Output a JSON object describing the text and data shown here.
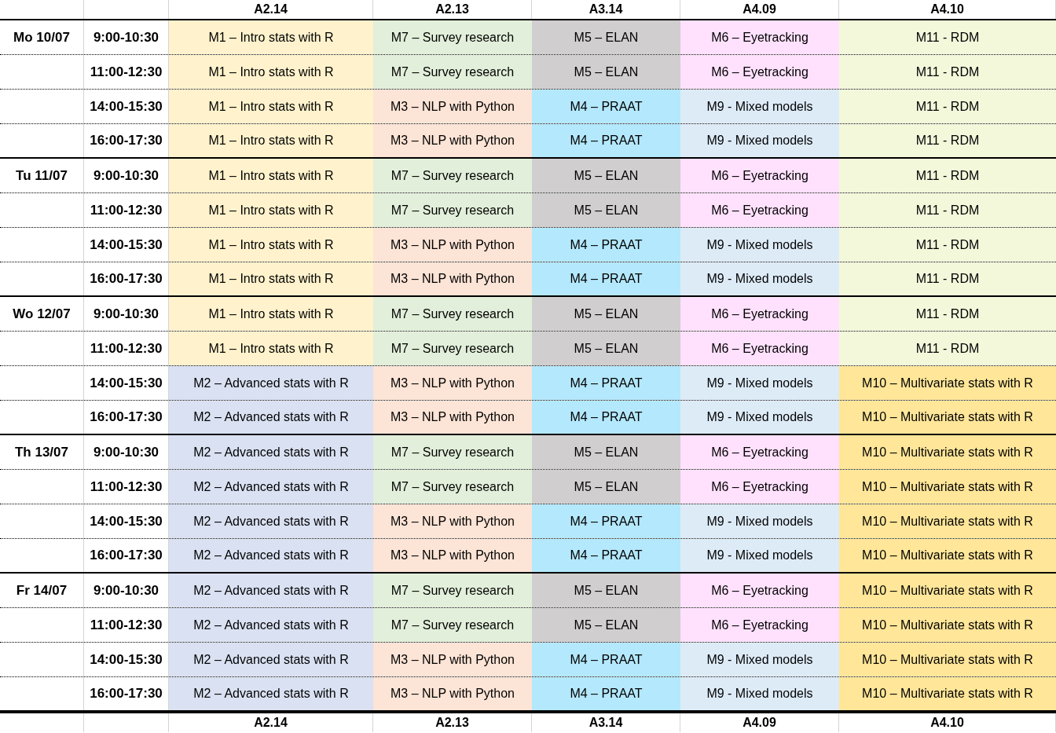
{
  "header": {
    "columns": [
      "A2.14",
      "A2.13",
      "A3.14",
      "A4.09",
      "A4.10"
    ]
  },
  "days": [
    {
      "label": "Mo 10/07",
      "slots": [
        {
          "time": "9:00-10:30",
          "cells": [
            {
              "text": "M1 – Intro stats with R",
              "color": "#fff2cc"
            },
            {
              "text": "M7 – Survey research",
              "color": "#e2efda"
            },
            {
              "text": "M5 – ELAN",
              "color": "#d0cece"
            },
            {
              "text": "M6 – Eyetracking",
              "color": "#ffe1fd"
            },
            {
              "text": "M11 - RDM",
              "color": "#f3f8db"
            }
          ]
        },
        {
          "time": "11:00-12:30",
          "cells": [
            {
              "text": "M1 – Intro stats with R",
              "color": "#fff2cc"
            },
            {
              "text": "M7 – Survey research",
              "color": "#e2efda"
            },
            {
              "text": "M5 – ELAN",
              "color": "#d0cece"
            },
            {
              "text": "M6 – Eyetracking",
              "color": "#ffe1fd"
            },
            {
              "text": "M11 - RDM",
              "color": "#f3f8db"
            }
          ]
        },
        {
          "time": "14:00-15:30",
          "cells": [
            {
              "text": "M1 – Intro stats with R",
              "color": "#fff2cc"
            },
            {
              "text": "M3 – NLP with Python",
              "color": "#fce4d6"
            },
            {
              "text": "M4 – PRAAT",
              "color": "#b4e8fc"
            },
            {
              "text": "M9 - Mixed models",
              "color": "#ddebf7"
            },
            {
              "text": "M11 - RDM",
              "color": "#f3f8db"
            }
          ]
        },
        {
          "time": "16:00-17:30",
          "cells": [
            {
              "text": "M1 – Intro stats with R",
              "color": "#fff2cc"
            },
            {
              "text": "M3 – NLP with Python",
              "color": "#fce4d6"
            },
            {
              "text": "M4 – PRAAT",
              "color": "#b4e8fc"
            },
            {
              "text": "M9 - Mixed models",
              "color": "#ddebf7"
            },
            {
              "text": "M11 - RDM",
              "color": "#f3f8db"
            }
          ]
        }
      ]
    },
    {
      "label": "Tu 11/07",
      "slots": [
        {
          "time": "9:00-10:30",
          "cells": [
            {
              "text": "M1 – Intro stats with R",
              "color": "#fff2cc"
            },
            {
              "text": "M7 – Survey research",
              "color": "#e2efda"
            },
            {
              "text": "M5 – ELAN",
              "color": "#d0cece"
            },
            {
              "text": "M6 – Eyetracking",
              "color": "#ffe1fd"
            },
            {
              "text": "M11 - RDM",
              "color": "#f3f8db"
            }
          ]
        },
        {
          "time": "11:00-12:30",
          "cells": [
            {
              "text": "M1 – Intro stats with R",
              "color": "#fff2cc"
            },
            {
              "text": "M7 – Survey research",
              "color": "#e2efda"
            },
            {
              "text": "M5 – ELAN",
              "color": "#d0cece"
            },
            {
              "text": "M6 – Eyetracking",
              "color": "#ffe1fd"
            },
            {
              "text": "M11 - RDM",
              "color": "#f3f8db"
            }
          ]
        },
        {
          "time": "14:00-15:30",
          "cells": [
            {
              "text": "M1 – Intro stats with R",
              "color": "#fff2cc"
            },
            {
              "text": "M3 – NLP with Python",
              "color": "#fce4d6"
            },
            {
              "text": "M4 – PRAAT",
              "color": "#b4e8fc"
            },
            {
              "text": "M9 - Mixed models",
              "color": "#ddebf7"
            },
            {
              "text": "M11 - RDM",
              "color": "#f3f8db"
            }
          ]
        },
        {
          "time": "16:00-17:30",
          "cells": [
            {
              "text": "M1 – Intro stats with R",
              "color": "#fff2cc"
            },
            {
              "text": "M3 – NLP with Python",
              "color": "#fce4d6"
            },
            {
              "text": "M4 – PRAAT",
              "color": "#b4e8fc"
            },
            {
              "text": "M9 - Mixed models",
              "color": "#ddebf7"
            },
            {
              "text": "M11 - RDM",
              "color": "#f3f8db"
            }
          ]
        }
      ]
    },
    {
      "label": "Wo 12/07",
      "slots": [
        {
          "time": "9:00-10:30",
          "cells": [
            {
              "text": "M1 – Intro stats with R",
              "color": "#fff2cc"
            },
            {
              "text": "M7 – Survey research",
              "color": "#e2efda"
            },
            {
              "text": "M5 – ELAN",
              "color": "#d0cece"
            },
            {
              "text": "M6 – Eyetracking",
              "color": "#ffe1fd"
            },
            {
              "text": "M11 - RDM",
              "color": "#f3f8db"
            }
          ]
        },
        {
          "time": "11:00-12:30",
          "cells": [
            {
              "text": "M1 – Intro stats with R",
              "color": "#fff2cc"
            },
            {
              "text": "M7 – Survey research",
              "color": "#e2efda"
            },
            {
              "text": "M5 – ELAN",
              "color": "#d0cece"
            },
            {
              "text": "M6 – Eyetracking",
              "color": "#ffe1fd"
            },
            {
              "text": "M11 - RDM",
              "color": "#f3f8db"
            }
          ]
        },
        {
          "time": "14:00-15:30",
          "cells": [
            {
              "text": "M2 – Advanced stats with R",
              "color": "#d9e1f2"
            },
            {
              "text": "M3 – NLP with Python",
              "color": "#fce4d6"
            },
            {
              "text": "M4 – PRAAT",
              "color": "#b4e8fc"
            },
            {
              "text": "M9 - Mixed models",
              "color": "#ddebf7"
            },
            {
              "text": "M10 – Multivariate stats with R",
              "color": "#ffe699"
            }
          ]
        },
        {
          "time": "16:00-17:30",
          "cells": [
            {
              "text": "M2 – Advanced stats with R",
              "color": "#d9e1f2"
            },
            {
              "text": "M3 – NLP with Python",
              "color": "#fce4d6"
            },
            {
              "text": "M4 – PRAAT",
              "color": "#b4e8fc"
            },
            {
              "text": "M9 - Mixed models",
              "color": "#ddebf7"
            },
            {
              "text": "M10 – Multivariate stats with R",
              "color": "#ffe699"
            }
          ]
        }
      ]
    },
    {
      "label": "Th 13/07",
      "slots": [
        {
          "time": "9:00-10:30",
          "cells": [
            {
              "text": "M2 – Advanced stats with R",
              "color": "#d9e1f2"
            },
            {
              "text": "M7 – Survey research",
              "color": "#e2efda"
            },
            {
              "text": "M5 – ELAN",
              "color": "#d0cece"
            },
            {
              "text": "M6 – Eyetracking",
              "color": "#ffe1fd"
            },
            {
              "text": "M10 – Multivariate stats with R",
              "color": "#ffe699"
            }
          ]
        },
        {
          "time": "11:00-12:30",
          "cells": [
            {
              "text": "M2 – Advanced stats with R",
              "color": "#d9e1f2"
            },
            {
              "text": "M7 – Survey research",
              "color": "#e2efda"
            },
            {
              "text": "M5 – ELAN",
              "color": "#d0cece"
            },
            {
              "text": "M6 – Eyetracking",
              "color": "#ffe1fd"
            },
            {
              "text": "M10 – Multivariate stats with R",
              "color": "#ffe699"
            }
          ]
        },
        {
          "time": "14:00-15:30",
          "cells": [
            {
              "text": "M2 – Advanced stats with R",
              "color": "#d9e1f2"
            },
            {
              "text": "M3 – NLP with Python",
              "color": "#fce4d6"
            },
            {
              "text": "M4 – PRAAT",
              "color": "#b4e8fc"
            },
            {
              "text": "M9 - Mixed models",
              "color": "#ddebf7"
            },
            {
              "text": "M10 – Multivariate stats with R",
              "color": "#ffe699"
            }
          ]
        },
        {
          "time": "16:00-17:30",
          "cells": [
            {
              "text": "M2 – Advanced stats with R",
              "color": "#d9e1f2"
            },
            {
              "text": "M3 – NLP with Python",
              "color": "#fce4d6"
            },
            {
              "text": "M4 – PRAAT",
              "color": "#b4e8fc"
            },
            {
              "text": "M9 - Mixed models",
              "color": "#ddebf7"
            },
            {
              "text": "M10 – Multivariate stats with R",
              "color": "#ffe699"
            }
          ]
        }
      ]
    },
    {
      "label": "Fr 14/07",
      "slots": [
        {
          "time": "9:00-10:30",
          "cells": [
            {
              "text": "M2 – Advanced stats with R",
              "color": "#d9e1f2"
            },
            {
              "text": "M7 – Survey research",
              "color": "#e2efda"
            },
            {
              "text": "M5 – ELAN",
              "color": "#d0cece"
            },
            {
              "text": "M6 – Eyetracking",
              "color": "#ffe1fd"
            },
            {
              "text": "M10 – Multivariate stats with R",
              "color": "#ffe699"
            }
          ]
        },
        {
          "time": "11:00-12:30",
          "cells": [
            {
              "text": "M2 – Advanced stats with R",
              "color": "#d9e1f2"
            },
            {
              "text": "M7 – Survey research",
              "color": "#e2efda"
            },
            {
              "text": "M5 – ELAN",
              "color": "#d0cece"
            },
            {
              "text": "M6 – Eyetracking",
              "color": "#ffe1fd"
            },
            {
              "text": "M10 – Multivariate stats with R",
              "color": "#ffe699"
            }
          ]
        },
        {
          "time": "14:00-15:30",
          "cells": [
            {
              "text": "M2 – Advanced stats with R",
              "color": "#d9e1f2"
            },
            {
              "text": "M3 – NLP with Python",
              "color": "#fce4d6"
            },
            {
              "text": "M4 – PRAAT",
              "color": "#b4e8fc"
            },
            {
              "text": "M9 - Mixed models",
              "color": "#ddebf7"
            },
            {
              "text": "M10 – Multivariate stats with R",
              "color": "#ffe699"
            }
          ]
        },
        {
          "time": "16:00-17:30",
          "cells": [
            {
              "text": "M2 – Advanced stats with R",
              "color": "#d9e1f2"
            },
            {
              "text": "M3 – NLP with Python",
              "color": "#fce4d6"
            },
            {
              "text": "M4 – PRAAT",
              "color": "#b4e8fc"
            },
            {
              "text": "M9 - Mixed models",
              "color": "#ddebf7"
            },
            {
              "text": "M10 – Multivariate stats with R",
              "color": "#ffe699"
            }
          ]
        }
      ]
    }
  ],
  "footer": {
    "columns": [
      "A2.14",
      "A2.13",
      "A3.14",
      "A4.09",
      "A4.10"
    ]
  }
}
